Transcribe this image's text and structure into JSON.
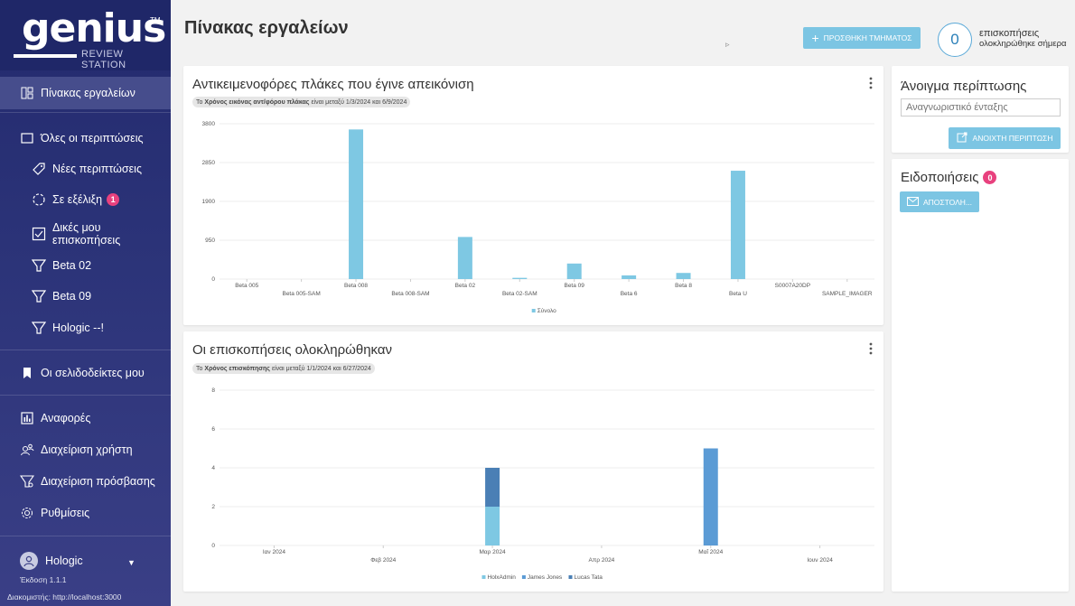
{
  "app": {
    "logo_word": "genius",
    "logo_tm": "TM",
    "logo_sub": "REVIEW STATION"
  },
  "sidebar": {
    "items": [
      {
        "label": "Πίνακας εργαλείων",
        "icon": "dashboard-icon"
      },
      {
        "label": "Όλες οι περιπτώσεις",
        "icon": "square-icon"
      },
      {
        "label": "Νέες περιπτώσεις",
        "icon": "tag-icon"
      },
      {
        "label": "Σε εξέλιξη",
        "icon": "progress-icon",
        "badge": "1"
      },
      {
        "label": "Δικές μου επισκοπήσεις",
        "icon": "checkbox-icon"
      },
      {
        "label": "Beta 02",
        "icon": "filter-icon"
      },
      {
        "label": "Beta 09",
        "icon": "filter-icon"
      },
      {
        "label": "Hologic --!",
        "icon": "filter-icon"
      },
      {
        "label": "Οι σελιδοδείκτες μου",
        "icon": "bookmark-icon"
      },
      {
        "label": "Αναφορές",
        "icon": "report-icon"
      },
      {
        "label": "Διαχείριση χρήστη",
        "icon": "users-icon"
      },
      {
        "label": "Διαχείριση πρόσβασης",
        "icon": "access-icon"
      },
      {
        "label": "Ρυθμίσεις",
        "icon": "gear-icon"
      }
    ],
    "user_name": "Hologic",
    "version": "Έκδοση 1.1.1",
    "server": "Διακομιστής: http://localhost:3000"
  },
  "header": {
    "title": "Πίνακας εργαλείων",
    "add_button": "ΠΡΟΣΘΗΚΗ ΤΜΗΜΑΤΟΣ",
    "reviews_count": "0",
    "reviews_label_1": "επισκοπήσεις",
    "reviews_label_2": "ολοκληρώθηκε σήμερα"
  },
  "chart1": {
    "title": "Αντικειμενοφόρες πλάκες που έγινε απεικόνιση",
    "filter_prefix": "Το",
    "filter_bold": "Χρόνος εικόνας αντ/φόρου πλάκας",
    "filter_rest": "είναι μεταξύ 1/3/2024 και 6/9/2024"
  },
  "chart2": {
    "title": "Οι επισκοπήσεις ολοκληρώθηκαν",
    "filter_prefix": "Το",
    "filter_bold": "Χρόνος επισκόπησης",
    "filter_rest": "είναι μεταξύ 1/1/2024 και 6/27/2024"
  },
  "right": {
    "case_title": "Άνοιγμα περίπτωσης",
    "case_placeholder": "Αναγνωριστικό ένταξης",
    "open_button": "ΑΝΟΙΧΤΗ ΠΕΡΙΠΤΩΣΗ",
    "notif_title": "Ειδοποιήσεις",
    "notif_count": "0",
    "send_button": "ΑΠΟΣΤΟΛΗ..."
  },
  "chart_data": [
    {
      "type": "bar",
      "categories": [
        "Beta 005",
        "Beta 005-SAM",
        "Beta 008",
        "Beta 008-SAM",
        "Beta 02",
        "Beta 02-SAM",
        "Beta 09",
        "Beta 6",
        "Beta 8",
        "Beta U",
        "S0007A20DP",
        "SAMPLE_IMAGER"
      ],
      "series": [
        {
          "name": "Σύνολο",
          "values": [
            0,
            0,
            3660,
            0,
            1030,
            30,
            380,
            90,
            150,
            2650,
            0,
            0
          ],
          "color": "#7ec8e3"
        }
      ],
      "ylim": [
        0,
        3800
      ],
      "yticks": [
        "0",
        "950",
        "1900",
        "2850",
        "3800"
      ],
      "legend": "bottom"
    },
    {
      "type": "bar",
      "stacked": true,
      "categories": [
        "Ιαν 2024",
        "Φεβ 2024",
        "Μαρ 2024",
        "Απρ 2024",
        "Μαΐ 2024",
        "Ιουν 2024"
      ],
      "series": [
        {
          "name": "HolxAdmin",
          "values": [
            0,
            0,
            2,
            0,
            0,
            0
          ],
          "color": "#7ec8e3"
        },
        {
          "name": "James Jones",
          "values": [
            0,
            0,
            0,
            0,
            5,
            0
          ],
          "color": "#5b9bd5"
        },
        {
          "name": "Lucas Tata",
          "values": [
            0,
            0,
            2,
            0,
            0,
            0
          ],
          "color": "#4a7fb5"
        }
      ],
      "ylim": [
        0,
        8
      ],
      "yticks": [
        "0",
        "2",
        "4",
        "6",
        "8"
      ],
      "legend": "bottom"
    }
  ]
}
